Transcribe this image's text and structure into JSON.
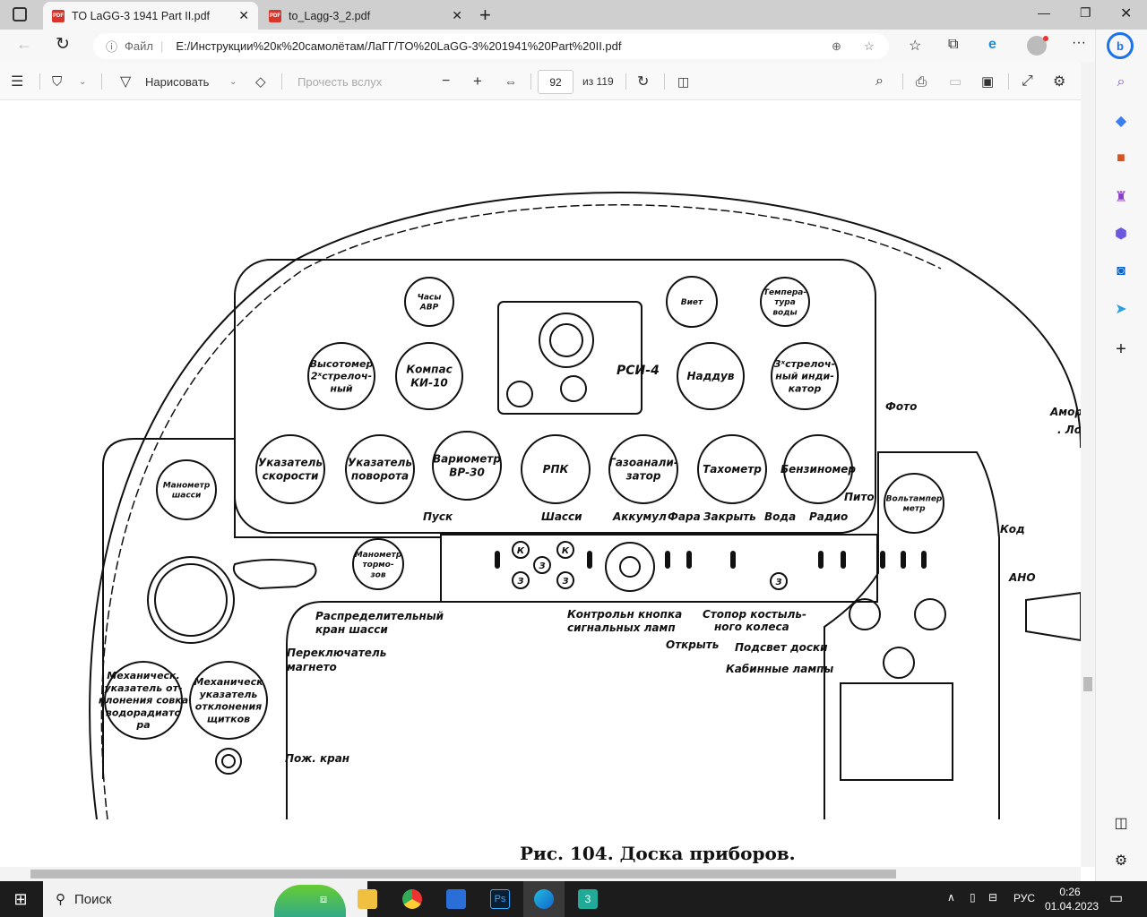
{
  "browser": {
    "tabs": [
      {
        "label": "TO LaGG-3 1941 Part II.pdf",
        "active": true
      },
      {
        "label": "to_Lagg-3_2.pdf",
        "active": false
      }
    ],
    "address": {
      "scheme_label": "Файл",
      "url": "E:/Инструкции%20к%20самолётам/ЛаГГ/TO%20LaGG-3%201941%20Part%20II.pdf"
    }
  },
  "pdf_toolbar": {
    "draw_label": "Нарисовать",
    "read_aloud_label": "Прочесть вслух",
    "page_current": "92",
    "page_total": "из 119"
  },
  "diagram": {
    "gauges": [
      [
        "Часы",
        "АВР"
      ],
      [
        "Виет"
      ],
      [
        "Темпера-",
        "тура",
        "воды"
      ],
      [
        "Высотомер",
        "2ˣстрелоч-",
        "ный"
      ],
      [
        "Компас",
        "КИ-10"
      ],
      [
        "Наддув"
      ],
      [
        "3ˣстрелоч-",
        "ный инди-",
        "катор"
      ],
      [
        "Указатель",
        "скорости"
      ],
      [
        "Указатель",
        "поворота"
      ],
      [
        "Вариометр",
        "ВР-30"
      ],
      [
        "РПК"
      ],
      [
        "Газоанали-",
        "затор"
      ],
      [
        "Тахометр"
      ],
      [
        "Бензиномер"
      ],
      [
        "Манометр",
        "шасси"
      ],
      [
        "Вольтампер",
        "метр"
      ],
      [
        "Манометр",
        "тормо-",
        "зов"
      ],
      [
        "Механическ.",
        "указатель от-",
        "клонения совка",
        "водорадиато",
        "ра"
      ],
      [
        "Механическ",
        "указатель",
        "отклонения",
        "щитков"
      ]
    ],
    "radio_label": "РСИ-4",
    "callouts": [
      "Пуск",
      "Шасси",
      "Аккумул",
      "Фара",
      "Закрыть",
      "Вода",
      "Радио",
      "Пито",
      "Фото",
      "Код",
      "АНО",
      "Распределительный",
      "кран  шасси",
      "Переключатель",
      "магнето",
      "Контрольн  кнопка",
      "сигнальных  ламп",
      "Стопор  костыль-",
      "ного  колеса",
      "Открыть",
      "Подсвет  доски",
      "Кабинные  лампы",
      "Пож. кран",
      "Амор",
      ". Лоп"
    ],
    "switch_marks": [
      "К",
      "К",
      "З",
      "З",
      "З",
      "З"
    ],
    "caption": "Рис. 104. Доска приборов."
  },
  "taskbar": {
    "search_label": "Поиск",
    "lang": "РУС",
    "time": "0:26",
    "date": "01.04.2023"
  }
}
